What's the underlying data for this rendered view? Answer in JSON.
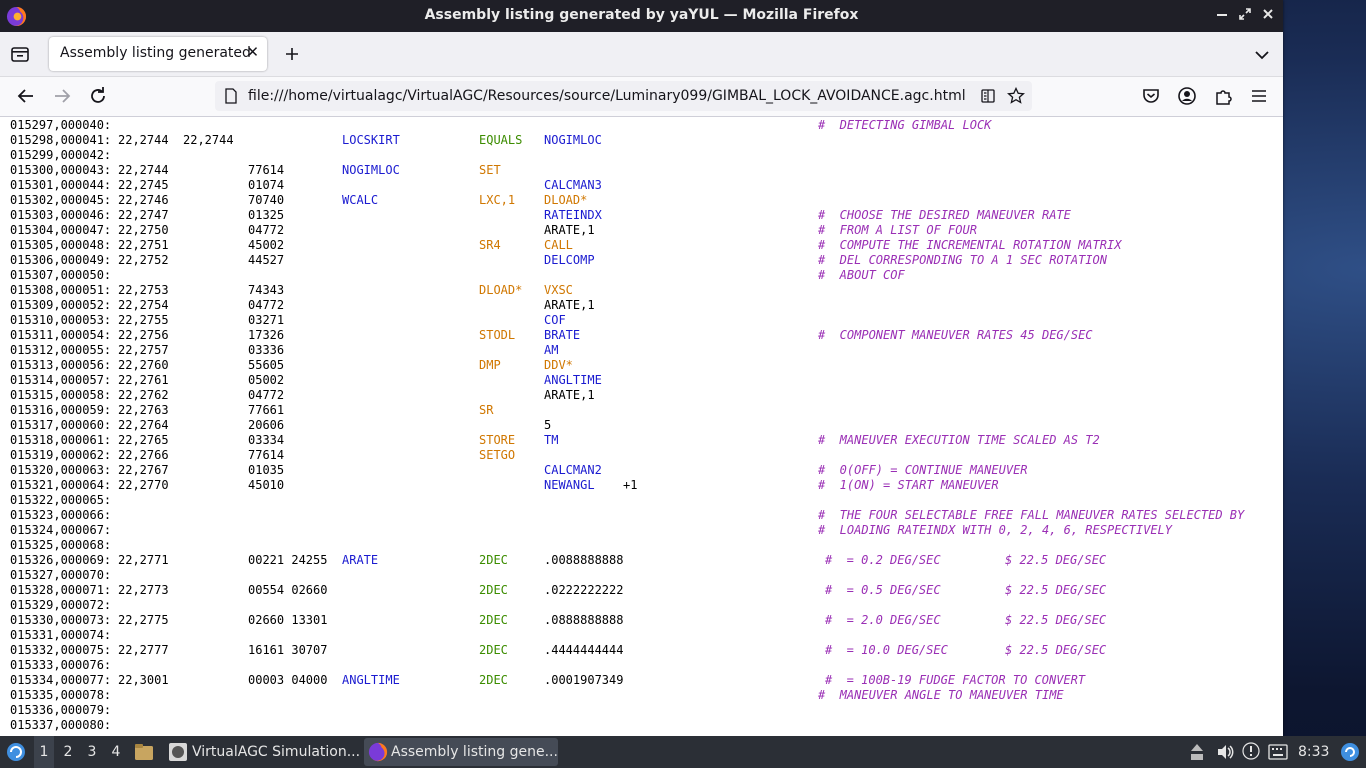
{
  "window": {
    "title": "Assembly listing generated by yaYUL — Mozilla Firefox"
  },
  "tab": {
    "label": "Assembly listing generated",
    "close": "✕"
  },
  "navbar": {
    "url": "file:///home/virtualagc/VirtualAGC/Resources/source/Luminary099/GIMBAL_LOCK_AVOIDANCE.agc.html"
  },
  "listing": [
    {
      "id": "015297,000040:",
      "comment": "#  DETECTING GIMBAL LOCK"
    },
    {
      "id": "015298,000041:",
      "addr": "22,2744",
      "addr2": "22,2744",
      "label": "LOCSKIRT",
      "op": "EQUALS",
      "opcolor": "green",
      "operand": "NOGIMLOC",
      "operandcolor": "blue"
    },
    {
      "id": "015299,000042:"
    },
    {
      "id": "015300,000043:",
      "addr": "22,2744",
      "code": "77614",
      "label": "NOGIMLOC",
      "op": "SET"
    },
    {
      "id": "015301,000044:",
      "addr": "22,2745",
      "code": "01074",
      "operand": "CALCMAN3",
      "operandcolor": "blue"
    },
    {
      "id": "015302,000045:",
      "addr": "22,2746",
      "code": "70740",
      "label": "WCALC",
      "op": "LXC,1",
      "operand": "DLOAD*",
      "operandcolor": "orange"
    },
    {
      "id": "015303,000046:",
      "addr": "22,2747",
      "code": "01325",
      "operand": "RATEINDX",
      "operandcolor": "blue",
      "comment": "#  CHOOSE THE DESIRED MANEUVER RATE"
    },
    {
      "id": "015304,000047:",
      "addr": "22,2750",
      "code": "04772",
      "operand": "ARATE,1",
      "comment": "#  FROM A LIST OF FOUR"
    },
    {
      "id": "015305,000048:",
      "addr": "22,2751",
      "code": "45002",
      "op": "SR4",
      "operand": "CALL",
      "operandcolor": "orange",
      "comment": "#  COMPUTE THE INCREMENTAL ROTATION MATRIX"
    },
    {
      "id": "015306,000049:",
      "addr": "22,2752",
      "code": "44527",
      "operand": "DELCOMP",
      "operandcolor": "blue",
      "comment": "#  DEL CORRESPONDING TO A 1 SEC ROTATION"
    },
    {
      "id": "015307,000050:",
      "comment": "#  ABOUT COF"
    },
    {
      "id": "015308,000051:",
      "addr": "22,2753",
      "code": "74343",
      "op": "DLOAD*",
      "operand": "VXSC",
      "operandcolor": "orange"
    },
    {
      "id": "015309,000052:",
      "addr": "22,2754",
      "code": "04772",
      "operand": "ARATE,1"
    },
    {
      "id": "015310,000053:",
      "addr": "22,2755",
      "code": "03271",
      "operand": "COF",
      "operandcolor": "blue"
    },
    {
      "id": "015311,000054:",
      "addr": "22,2756",
      "code": "17326",
      "op": "STODL",
      "operand": "BRATE",
      "operandcolor": "blue",
      "comment": "#  COMPONENT MANEUVER RATES 45 DEG/SEC"
    },
    {
      "id": "015312,000055:",
      "addr": "22,2757",
      "code": "03336",
      "operand": "AM",
      "operandcolor": "blue"
    },
    {
      "id": "015313,000056:",
      "addr": "22,2760",
      "code": "55605",
      "op": "DMP",
      "operand": "DDV*",
      "operandcolor": "orange"
    },
    {
      "id": "015314,000057:",
      "addr": "22,2761",
      "code": "05002",
      "operand": "ANGLTIME",
      "operandcolor": "blue"
    },
    {
      "id": "015315,000058:",
      "addr": "22,2762",
      "code": "04772",
      "operand": "ARATE,1"
    },
    {
      "id": "015316,000059:",
      "addr": "22,2763",
      "code": "77661",
      "op": "SR"
    },
    {
      "id": "015317,000060:",
      "addr": "22,2764",
      "code": "20606",
      "operand": "5"
    },
    {
      "id": "015318,000061:",
      "addr": "22,2765",
      "code": "03334",
      "op": "STORE",
      "operand": "TM",
      "operandcolor": "blue",
      "comment": "#  MANEUVER EXECUTION TIME SCALED AS T2"
    },
    {
      "id": "015319,000062:",
      "addr": "22,2766",
      "code": "77614",
      "op": "SETGO"
    },
    {
      "id": "015320,000063:",
      "addr": "22,2767",
      "code": "01035",
      "operand": "CALCMAN2",
      "operandcolor": "blue",
      "comment": "#  0(OFF) = CONTINUE MANEUVER"
    },
    {
      "id": "015321,000064:",
      "addr": "22,2770",
      "code": "45010",
      "operand": "NEWANGL",
      "operandcolor": "blue",
      "extra": "+1",
      "comment": "#  1(ON) = START MANEUVER"
    },
    {
      "id": "015322,000065:"
    },
    {
      "id": "015323,000066:",
      "comment": "#  THE FOUR SELECTABLE FREE FALL MANEUVER RATES SELECTED BY"
    },
    {
      "id": "015324,000067:",
      "comment": "#  LOADING RATEINDX WITH 0, 2, 4, 6, RESPECTIVELY"
    },
    {
      "id": "015325,000068:"
    },
    {
      "id": "015326,000069:",
      "addr": "22,2771",
      "code": "00221 24255",
      "label": "ARATE",
      "op": "2DEC",
      "opcolor": "green",
      "operand": ".0088888888",
      "comment": "#  = 0.2 DEG/SEC",
      "comment2": "$ 22.5 DEG/SEC",
      "indent": true
    },
    {
      "id": "015327,000070:"
    },
    {
      "id": "015328,000071:",
      "addr": "22,2773",
      "code": "00554 02660",
      "op": "2DEC",
      "opcolor": "green",
      "operand": ".0222222222",
      "comment": "#  = 0.5 DEG/SEC",
      "comment2": "$ 22.5 DEG/SEC",
      "indent": true
    },
    {
      "id": "015329,000072:"
    },
    {
      "id": "015330,000073:",
      "addr": "22,2775",
      "code": "02660 13301",
      "op": "2DEC",
      "opcolor": "green",
      "operand": ".0888888888",
      "comment": "#  = 2.0 DEG/SEC",
      "comment2": "$ 22.5 DEG/SEC",
      "indent": true
    },
    {
      "id": "015331,000074:"
    },
    {
      "id": "015332,000075:",
      "addr": "22,2777",
      "code": "16161 30707",
      "op": "2DEC",
      "opcolor": "green",
      "operand": ".4444444444",
      "comment": "#  = 10.0 DEG/SEC",
      "comment2": "$ 22.5 DEG/SEC",
      "indent": true
    },
    {
      "id": "015333,000076:"
    },
    {
      "id": "015334,000077:",
      "addr": "22,3001",
      "code": "00003 04000",
      "label": "ANGLTIME",
      "op": "2DEC",
      "opcolor": "green",
      "operand": ".0001907349",
      "comment": "#  = 100B-19 FUDGE FACTOR TO CONVERT",
      "indent": true
    },
    {
      "id": "015335,000078:",
      "comment": "#  MANEUVER ANGLE TO MANEUVER TIME"
    },
    {
      "id": "015336,000079:"
    },
    {
      "id": "015337,000080:"
    }
  ],
  "taskbar": {
    "workspaces": [
      "1",
      "2",
      "3",
      "4"
    ],
    "tasks": [
      {
        "label": "VirtualAGC Simulation..."
      },
      {
        "label": "Assembly listing gene..."
      }
    ],
    "clock": "8:33"
  },
  "colors": {
    "label": "#1b1bd0",
    "opcode_orange": "#d07700",
    "opcode_green": "#3c8c00",
    "comment": "#9a2fb5",
    "titlebar": "#1f1f27",
    "taskbar": "#2b2f36"
  }
}
